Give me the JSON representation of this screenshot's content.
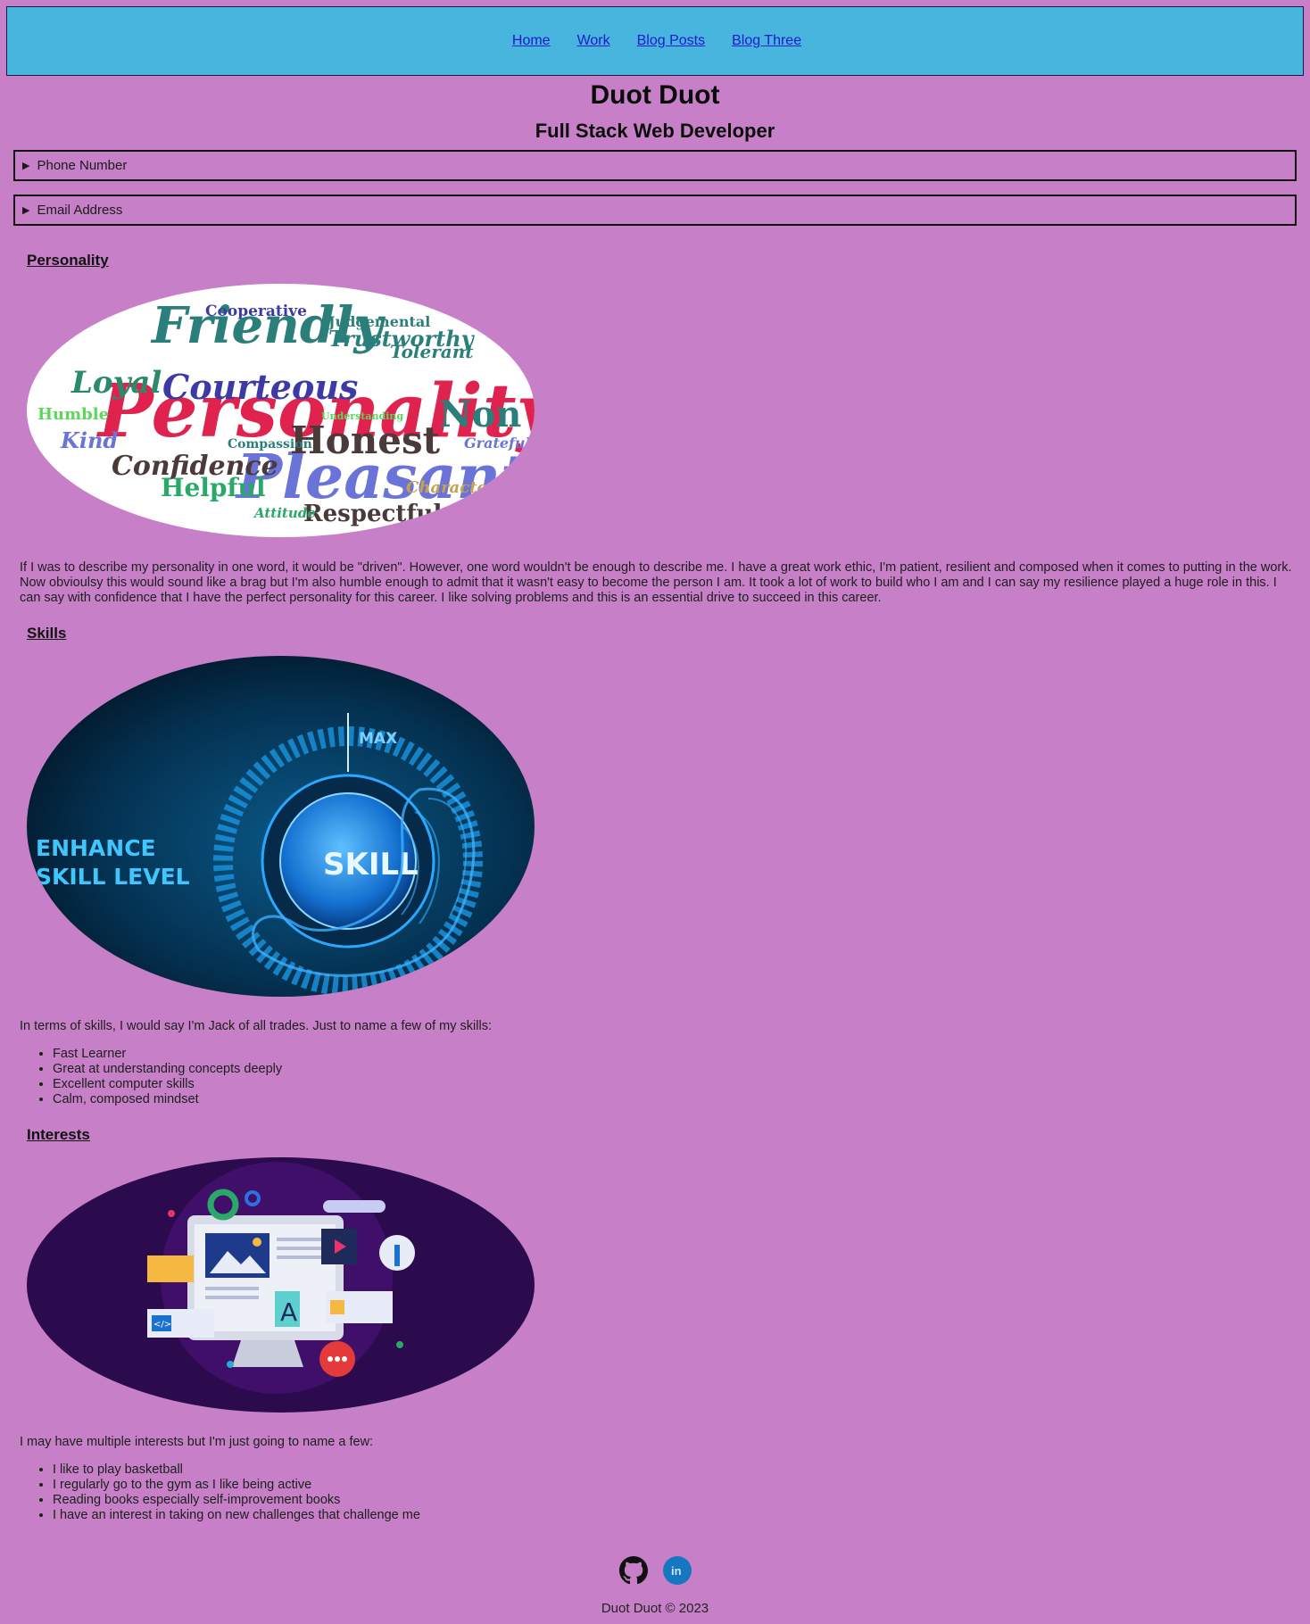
{
  "nav": {
    "items": [
      {
        "label": "Home"
      },
      {
        "label": "Work"
      },
      {
        "label": "Blog Posts"
      },
      {
        "label": "Blog Three"
      }
    ]
  },
  "header": {
    "name": "Duot Duot",
    "role": "Full Stack Web Developer"
  },
  "contact": {
    "phone_label": "Phone Number",
    "email_label": "Email Address"
  },
  "personality": {
    "title": "Personality",
    "text": "If I was to describe my personality in one word, it would be \"driven\". However, one word wouldn't be enough to describe me. I have a great work ethic, I'm patient, resilient and composed when it comes to putting in the work. Now obvioulsy this would sound like a brag but I'm also humble enough to admit that it wasn't easy to become the person I am. It took a lot of work to build who I am and I can say my resilience played a huge role in this. I can say with confidence that I have the perfect personality for this career. I like solving problems and this is an essential drive to succeed in this career.",
    "image_words": {
      "big1": "Personality",
      "big2": "Pleasant",
      "big3": "Friendly",
      "big4": "Courteous",
      "big5": "Honest",
      "big6": "Confidence",
      "big7": "Respectful",
      "big8": "Loyal",
      "big9": "Helpful",
      "big10": "Kind",
      "big11": "Humble",
      "big12": "Non",
      "big13": "Tolerant",
      "big14": "Trustworthy",
      "big15": "Judgemental",
      "big16": "Cooperative",
      "big17": "Character",
      "big18": "Grateful",
      "big19": "Compassion",
      "big20": "Attitude",
      "big21": "Understanding"
    }
  },
  "skills": {
    "title": "Skills",
    "image_text": {
      "line1": "ENHANCE",
      "line2": "SKILL LEVEL",
      "knob": "SKILL",
      "max": "MAX"
    },
    "intro": "In terms of skills, I would say I'm Jack of all trades. Just to name a few of my skills:",
    "items": [
      "Fast Learner",
      "Great at understanding concepts deeply",
      "Excellent computer skills",
      "Calm, composed mindset"
    ]
  },
  "interests": {
    "title": "Interests",
    "image_text": {
      "code": "</>",
      "letter": "A"
    },
    "intro": "I may have multiple interests but I'm just going to name a few:",
    "items": [
      "I like to play basketball",
      "I regularly go to the gym as I like being active",
      "Reading books especially self-improvement books",
      "I have an interest in taking on new challenges that challenge me"
    ]
  },
  "social": {
    "icons": [
      "github-icon",
      "linkedin-icon"
    ],
    "linkedin_glyph": "in"
  },
  "footer": {
    "text": "Duot Duot © 2023"
  },
  "colors": {
    "background": "#c780c8",
    "nav": "#48b5df",
    "link": "#1a1acc"
  }
}
